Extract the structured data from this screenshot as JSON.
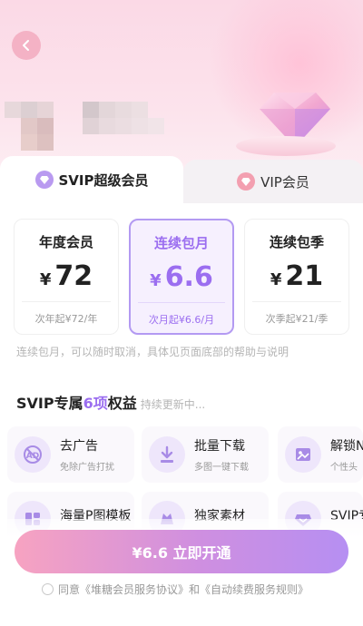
{
  "tabs": [
    {
      "label": "SVIP超级会员",
      "icon": "diamond-icon",
      "selected": true
    },
    {
      "label": "VIP会员",
      "icon": "diamond-icon",
      "selected": false
    }
  ],
  "plans": [
    {
      "name": "年度会员",
      "currency": "¥",
      "price": "72",
      "sub": "次年起¥72/年",
      "selected": false
    },
    {
      "name": "连续包月",
      "currency": "¥",
      "price": "6.6",
      "sub": "次月起¥6.6/月",
      "selected": true
    },
    {
      "name": "连续包季",
      "currency": "¥",
      "price": "21",
      "sub": "次季起¥21/季",
      "selected": false
    }
  ],
  "note": "连续包月，可以随时取消，具体见页面底部的帮助与说明",
  "benefits": {
    "title_prefix": "SVIP专属",
    "title_highlight": "6项",
    "title_suffix": "权益",
    "subtitle": "持续更新中...",
    "items": [
      {
        "title": "去广告",
        "desc": "免除广告打扰",
        "icon": "no-ads-icon"
      },
      {
        "title": "批量下载",
        "desc": "多图一键下载",
        "icon": "download-icon"
      },
      {
        "title": "解锁N",
        "desc": "个性头",
        "icon": "image-icon"
      },
      {
        "title": "海量P图模板",
        "desc": "",
        "icon": "template-icon"
      },
      {
        "title": "独家素材",
        "desc": "",
        "icon": "material-icon"
      },
      {
        "title": "SVIP专",
        "desc": "",
        "icon": "svip-badge-icon"
      }
    ]
  },
  "cta": {
    "label": "¥6.6 立即开通"
  },
  "agreement": {
    "text": "同意《堆糖会员服务协议》和《自动续费服务规则》"
  },
  "colors": {
    "accent": "#9b6ef0",
    "pink": "#f7a3c1"
  }
}
